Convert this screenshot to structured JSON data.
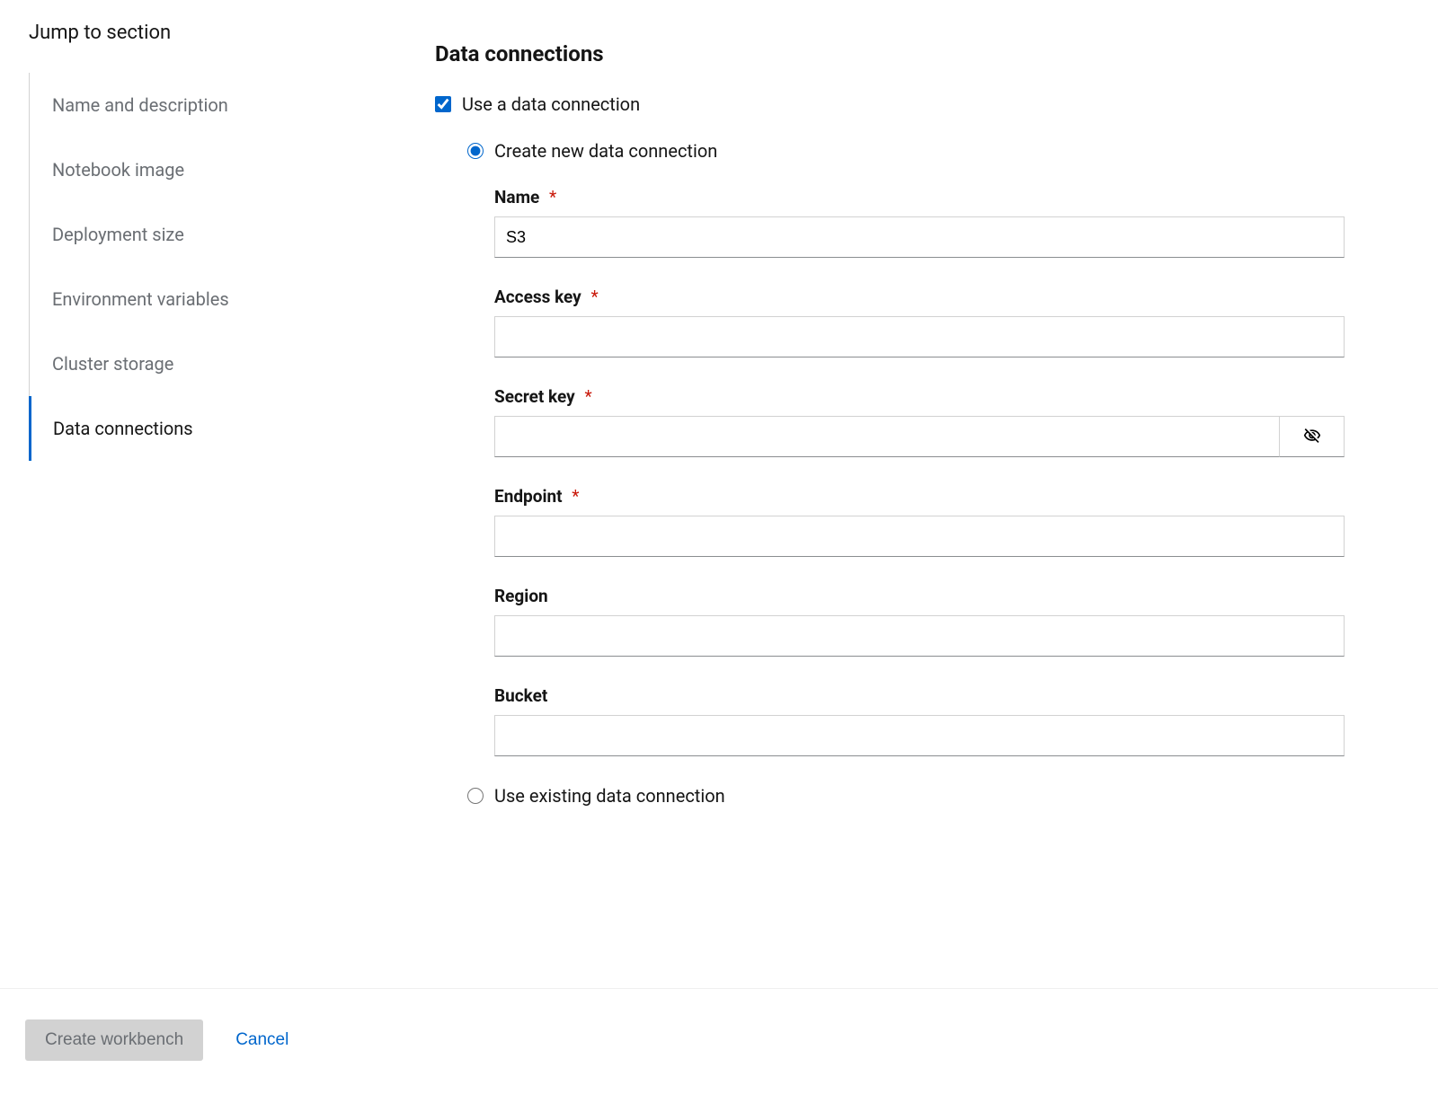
{
  "sidebar": {
    "title": "Jump to section",
    "items": [
      {
        "label": "Name and description",
        "active": false
      },
      {
        "label": "Notebook image",
        "active": false
      },
      {
        "label": "Deployment size",
        "active": false
      },
      {
        "label": "Environment variables",
        "active": false
      },
      {
        "label": "Cluster storage",
        "active": false
      },
      {
        "label": "Data connections",
        "active": true
      }
    ]
  },
  "main": {
    "section_title": "Data connections",
    "use_data_connection_label": "Use a data connection",
    "use_data_connection_checked": true,
    "radio_create_label": "Create new data connection",
    "radio_existing_label": "Use existing data connection",
    "radio_selected": "create",
    "fields": {
      "name_label": "Name",
      "name_value": "S3",
      "access_key_label": "Access key",
      "access_key_value": "",
      "secret_key_label": "Secret key",
      "secret_key_value": "",
      "endpoint_label": "Endpoint",
      "endpoint_value": "",
      "region_label": "Region",
      "region_value": "",
      "bucket_label": "Bucket",
      "bucket_value": ""
    },
    "required_mark": "*"
  },
  "footer": {
    "primary_label": "Create workbench",
    "cancel_label": "Cancel"
  }
}
